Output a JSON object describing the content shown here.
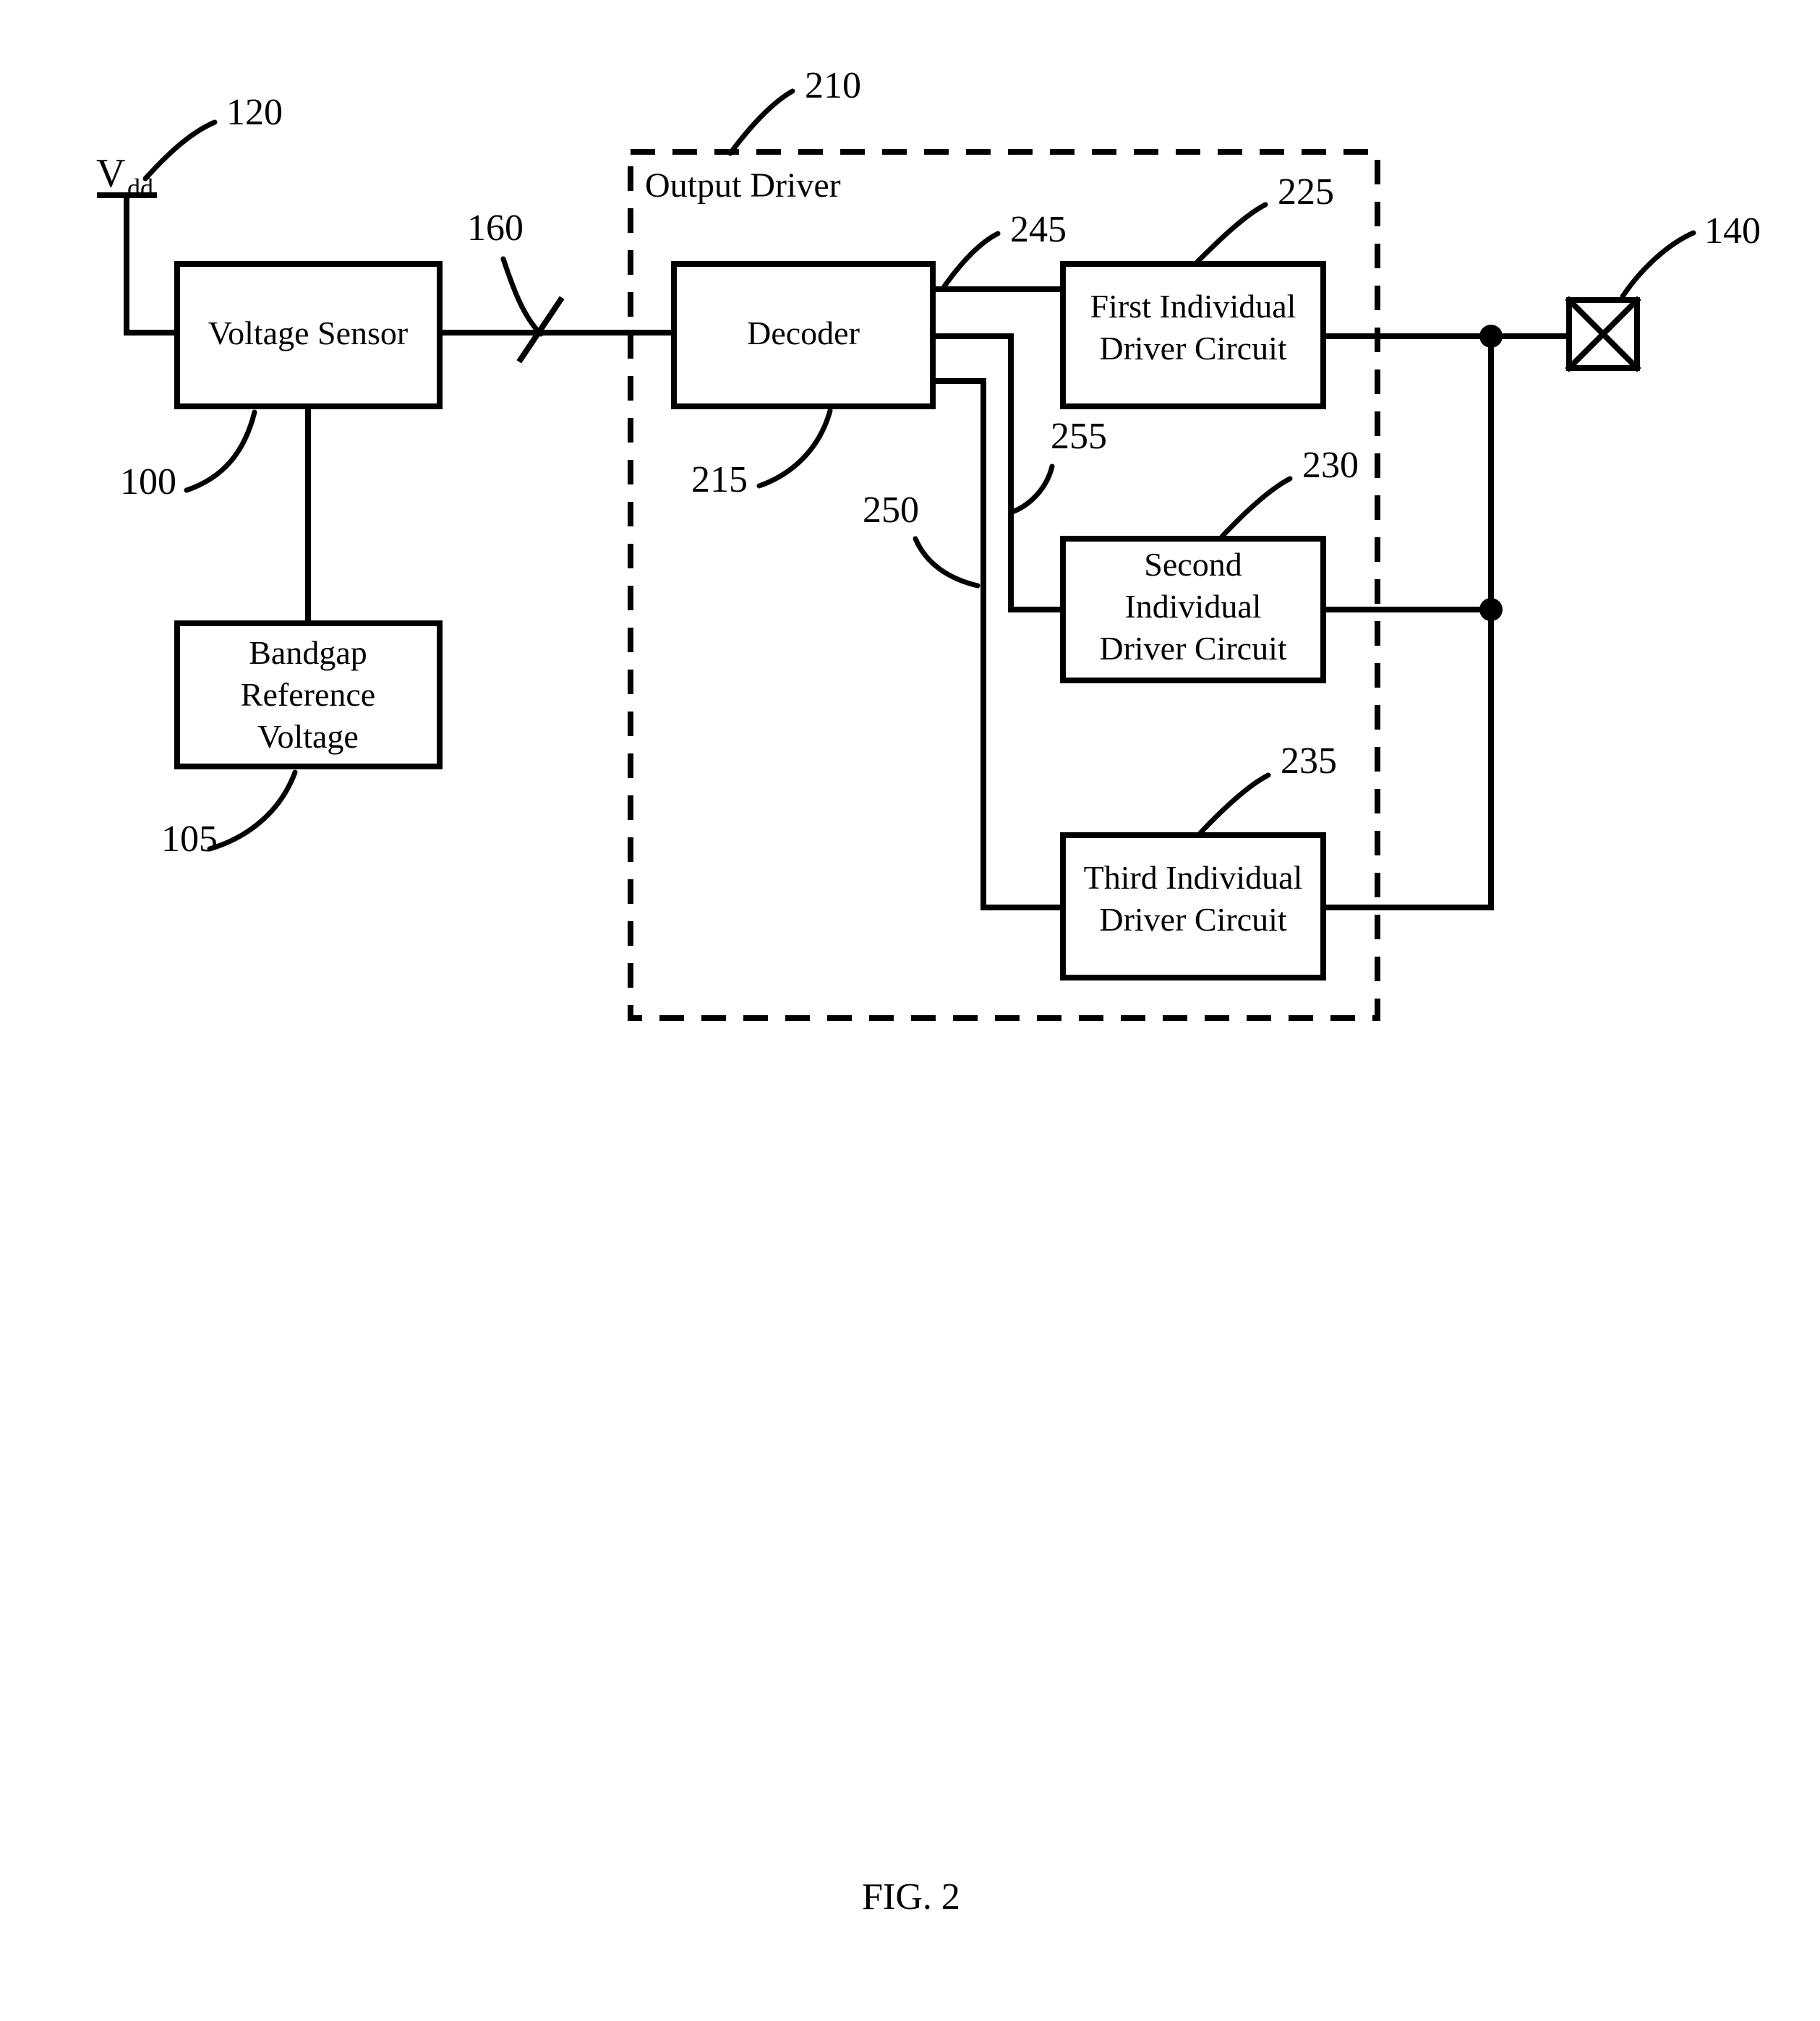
{
  "figure": {
    "caption": "FIG. 2",
    "supply": {
      "symbol": "V",
      "subscript": "dd"
    },
    "group_box_label": "Output Driver"
  },
  "blocks": {
    "voltage_sensor": {
      "label": "Voltage Sensor",
      "ref": "100"
    },
    "bandgap": {
      "line1": "Bandgap",
      "line2": "Reference",
      "line3": "Voltage",
      "ref": "105"
    },
    "decoder": {
      "label": "Decoder",
      "ref": "215"
    },
    "driver1": {
      "line1": "First Individual",
      "line2": "Driver Circuit",
      "ref": "225"
    },
    "driver2": {
      "line1": "Second",
      "line2": "Individual",
      "line3": "Driver Circuit",
      "ref": "230"
    },
    "driver3": {
      "line1": "Third Individual",
      "line2": "Driver Circuit",
      "ref": "235"
    }
  },
  "refs": {
    "supply": "120",
    "sensor": "100",
    "bandgap": "105",
    "bus": "160",
    "output_driver": "210",
    "decoder": "215",
    "driver1": "225",
    "driver2": "230",
    "driver3": "235",
    "line245": "245",
    "line250": "250",
    "line255": "255",
    "pad": "140"
  }
}
